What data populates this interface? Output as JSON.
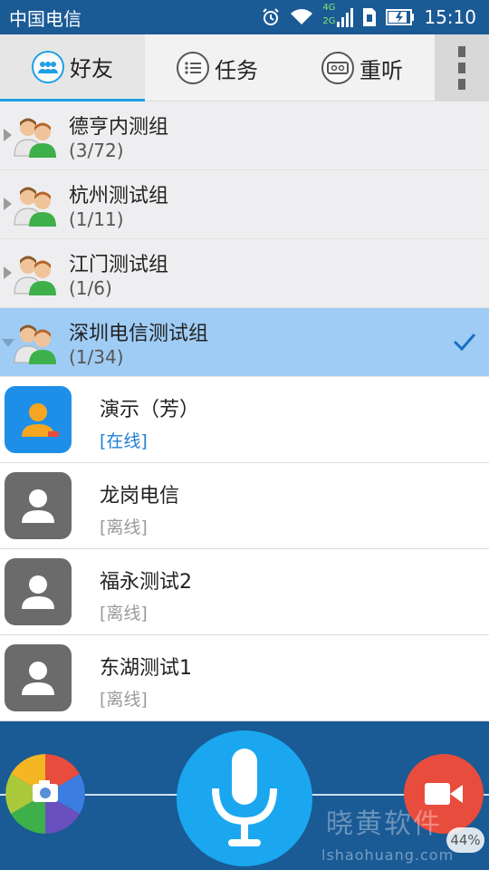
{
  "status_bar": {
    "carrier": "中国电信",
    "time": "15:10",
    "network_4g": "4G",
    "network_2g": "2G",
    "icons": [
      "alarm-icon",
      "wifi-icon",
      "signal-icon",
      "sim-icon",
      "battery-icon"
    ]
  },
  "tabs": [
    {
      "label": "好友",
      "icon": "friends-icon",
      "active": true
    },
    {
      "label": "任务",
      "icon": "task-list-icon",
      "active": false
    },
    {
      "label": "重听",
      "icon": "replay-tape-icon",
      "active": false
    }
  ],
  "groups": [
    {
      "name": "德亨内测组",
      "count": "(3/72)",
      "expanded": false
    },
    {
      "name": "杭州测试组",
      "count": "(1/11)",
      "expanded": false
    },
    {
      "name": "江门测试组",
      "count": "(1/6)",
      "expanded": false
    },
    {
      "name": "深圳电信测试组",
      "count": "(1/34)",
      "expanded": true
    }
  ],
  "contacts": [
    {
      "name": "演示（芳）",
      "status": "[在线]",
      "online": true
    },
    {
      "name": "龙岗电信",
      "status": "[离线]",
      "online": false
    },
    {
      "name": "福永测试2",
      "status": "[离线]",
      "online": false
    },
    {
      "name": "东湖测试1",
      "status": "[离线]",
      "online": false
    }
  ],
  "bottom_bar": {
    "camera_icon": "camera-icon",
    "mic_icon": "microphone-icon",
    "video_icon": "video-camera-icon",
    "watermark": "晓黄软件",
    "watermark_url": "lshaohuang.com",
    "percent": "44%"
  },
  "colors": {
    "primary_blue": "#1a5a95",
    "selected_row": "#9fccf5",
    "online_text": "#1e7fd6",
    "mic_blue": "#1aa7f0",
    "video_red": "#e84c3d"
  }
}
